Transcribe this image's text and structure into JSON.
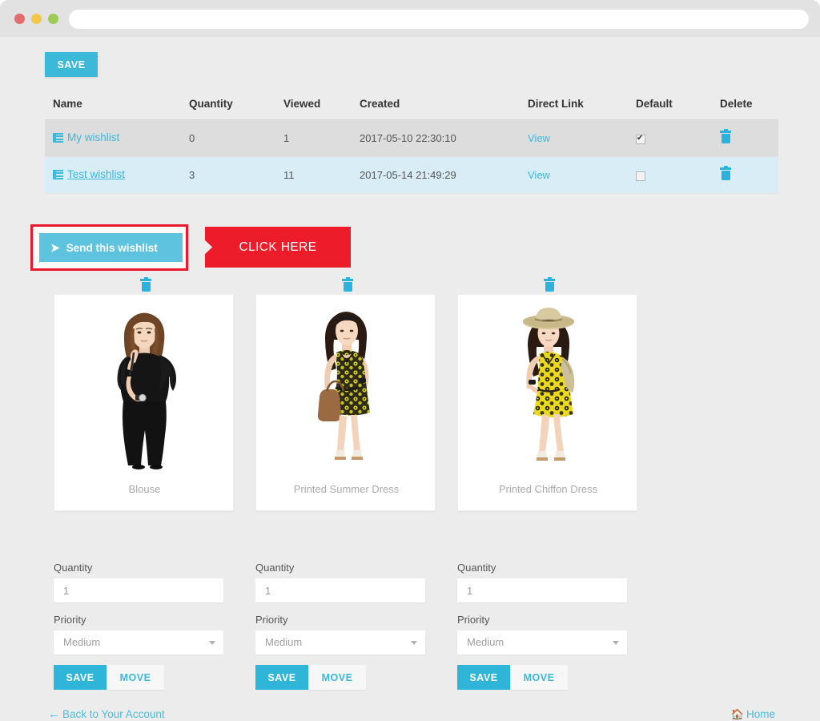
{
  "browser": {
    "url_value": "",
    "url_placeholder": "",
    "buttons": [
      "close",
      "minimize",
      "maximize"
    ]
  },
  "toolbar": {
    "save_label": "SAVE"
  },
  "table": {
    "headers": [
      "Name",
      "Quantity",
      "Viewed",
      "Created",
      "Direct Link",
      "Default",
      "Delete"
    ],
    "rows": [
      {
        "name": "My wishlist",
        "quantity": "0",
        "viewed": "1",
        "created": "2017-05-10 22:30:10",
        "direct_link": "View",
        "default_checked": true,
        "underlined": false
      },
      {
        "name": "Test wishlist",
        "quantity": "3",
        "viewed": "11",
        "created": "2017-05-14 21:49:29",
        "direct_link": "View",
        "default_checked": false,
        "underlined": true
      }
    ]
  },
  "send": {
    "button_label": "Send this wishlist",
    "icon": "paper-plane-icon",
    "highlight_color": "#e8192c"
  },
  "callout": {
    "label": "CLICK HERE",
    "color": "#ed1c2a"
  },
  "products": [
    {
      "name": "Blouse",
      "quantity_label": "Quantity",
      "quantity_value": "1",
      "priority_label": "Priority",
      "priority_value": "Medium",
      "save_label": "SAVE",
      "move_label": "MOVE"
    },
    {
      "name": "Printed Summer Dress",
      "quantity_label": "Quantity",
      "quantity_value": "1",
      "priority_label": "Priority",
      "priority_value": "Medium",
      "save_label": "SAVE",
      "move_label": "MOVE"
    },
    {
      "name": "Printed Chiffon Dress",
      "quantity_label": "Quantity",
      "quantity_value": "1",
      "priority_label": "Priority",
      "priority_value": "Medium",
      "save_label": "SAVE",
      "move_label": "MOVE"
    }
  ],
  "footer": {
    "back_label": "Back to Your Account",
    "back_icon": "arrow-left-icon",
    "home_label": "Home",
    "home_icon": "home-icon"
  },
  "colors": {
    "accent": "#3cb8d9",
    "highlight": "#ed1c2a",
    "page_bg": "#ececec",
    "row_hover": "#dddddd",
    "row_alt": "#d9edf7"
  }
}
